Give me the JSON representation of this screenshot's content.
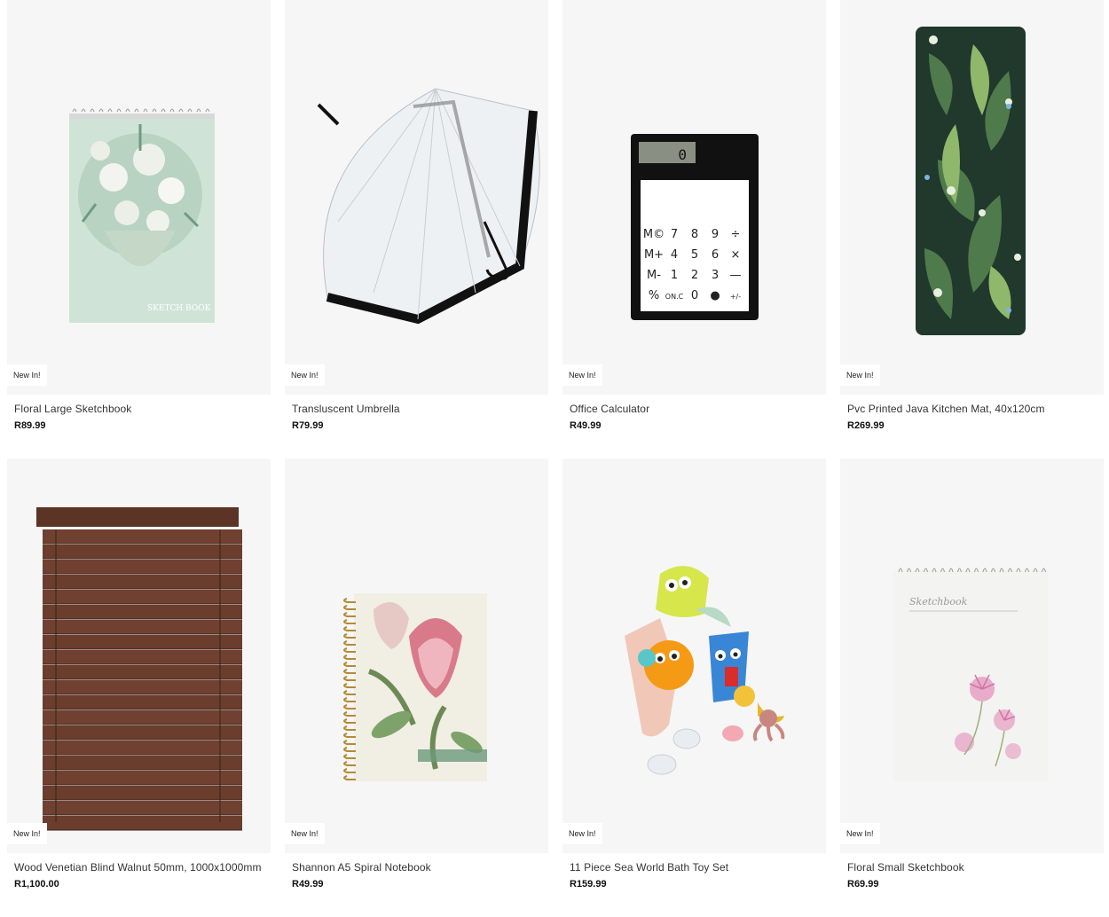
{
  "products": [
    {
      "name": "Floral Large Sketchbook",
      "price": "R89.99",
      "badge": "New In!",
      "icon": "sketchbook-large-image"
    },
    {
      "name": "Transluscent Umbrella",
      "price": "R79.99",
      "badge": "New In!",
      "icon": "umbrella-image"
    },
    {
      "name": "Office Calculator",
      "price": "R49.99",
      "badge": "New In!",
      "icon": "calculator-image"
    },
    {
      "name": "Pvc Printed Java Kitchen Mat, 40x120cm",
      "price": "R269.99",
      "badge": "New In!",
      "icon": "kitchen-mat-image"
    },
    {
      "name": "Wood Venetian Blind Walnut 50mm, 1000x1000mm",
      "price": "R1,100.00",
      "badge": "New In!",
      "icon": "venetian-blind-image"
    },
    {
      "name": "Shannon A5 Spiral Notebook",
      "price": "R49.99",
      "badge": "New In!",
      "icon": "spiral-notebook-image"
    },
    {
      "name": "11 Piece Sea World Bath Toy Set",
      "price": "R159.99",
      "badge": "New In!",
      "icon": "bath-toy-image"
    },
    {
      "name": "Floral Small Sketchbook",
      "price": "R69.99",
      "badge": "New In!",
      "icon": "sketchbook-small-image"
    }
  ],
  "images": {
    "sketchbook_cover_text": "SKETCH BOOK",
    "sketchbook_small_cover_text": "Sketchbook",
    "calculator_display": "0",
    "calculator_keys": [
      "M©",
      "7",
      "8",
      "9",
      "÷",
      "M+",
      "4",
      "5",
      "6",
      "×",
      "M-",
      "1",
      "2",
      "3",
      "—",
      "%",
      "ON.C",
      "0",
      "●",
      "+/-"
    ]
  }
}
